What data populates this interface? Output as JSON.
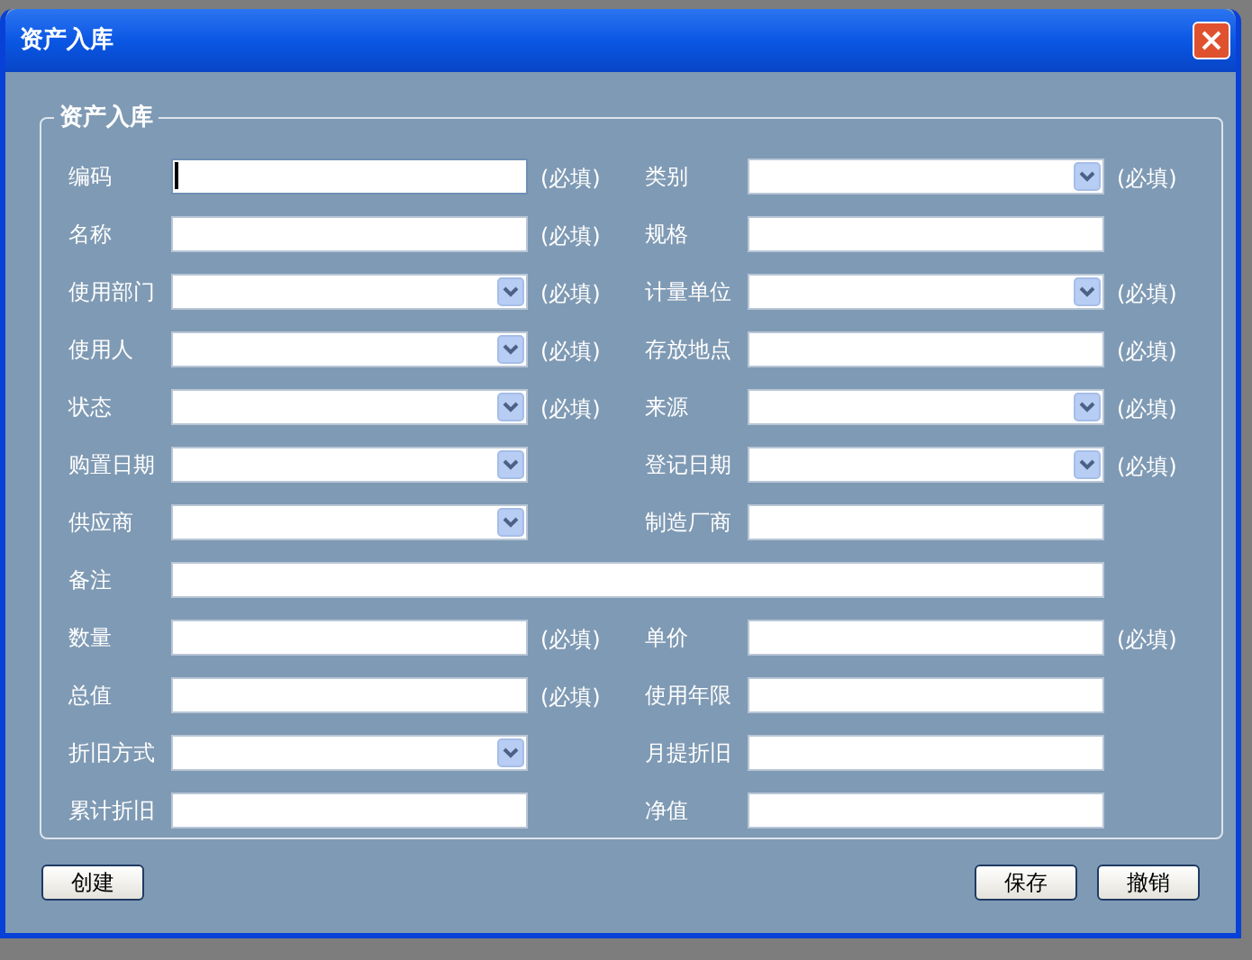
{
  "window": {
    "title": "资产入库"
  },
  "group": {
    "title": "资产入库"
  },
  "rows": [
    {
      "left": {
        "label": "编码",
        "kind": "text",
        "focused": true,
        "note": "(必填)"
      },
      "right": {
        "label": "类别",
        "kind": "select",
        "note": "(必填)"
      }
    },
    {
      "left": {
        "label": "名称",
        "kind": "text",
        "focused": false,
        "note": "(必填)"
      },
      "right": {
        "label": "规格",
        "kind": "text",
        "focused": false
      }
    },
    {
      "left": {
        "label": "使用部门",
        "kind": "select",
        "note": "(必填)"
      },
      "right": {
        "label": "计量单位",
        "kind": "select",
        "note": "(必填)"
      }
    },
    {
      "left": {
        "label": "使用人",
        "kind": "select",
        "note": "(必填)"
      },
      "right": {
        "label": "存放地点",
        "kind": "text",
        "focused": false,
        "note": "(必填)"
      }
    },
    {
      "left": {
        "label": "状态",
        "kind": "select",
        "note": "(必填)"
      },
      "right": {
        "label": "来源",
        "kind": "select",
        "note": "(必填)"
      }
    },
    {
      "left": {
        "label": "购置日期",
        "kind": "select"
      },
      "right": {
        "label": "登记日期",
        "kind": "select",
        "note": "(必填)"
      }
    },
    {
      "left": {
        "label": "供应商",
        "kind": "select"
      },
      "right": {
        "label": "制造厂商",
        "kind": "text",
        "focused": false
      }
    },
    {
      "left": {
        "label": "备注",
        "kind": "wide",
        "focused": false
      }
    },
    {
      "left": {
        "label": "数量",
        "kind": "text",
        "focused": false,
        "note": "(必填)"
      },
      "right": {
        "label": "单价",
        "kind": "text",
        "focused": false,
        "note": "(必填)"
      }
    },
    {
      "left": {
        "label": "总值",
        "kind": "text",
        "focused": false,
        "note": "(必填)"
      },
      "right": {
        "label": "使用年限",
        "kind": "text",
        "focused": false
      }
    },
    {
      "left": {
        "label": "折旧方式",
        "kind": "select"
      },
      "right": {
        "label": "月提折旧",
        "kind": "text",
        "focused": false
      }
    },
    {
      "left": {
        "label": "累计折旧",
        "kind": "text",
        "focused": false
      },
      "right": {
        "label": "净值",
        "kind": "text",
        "focused": false
      }
    }
  ],
  "buttons": {
    "left": [
      "创建"
    ],
    "right": [
      "保存",
      "撤销"
    ]
  }
}
